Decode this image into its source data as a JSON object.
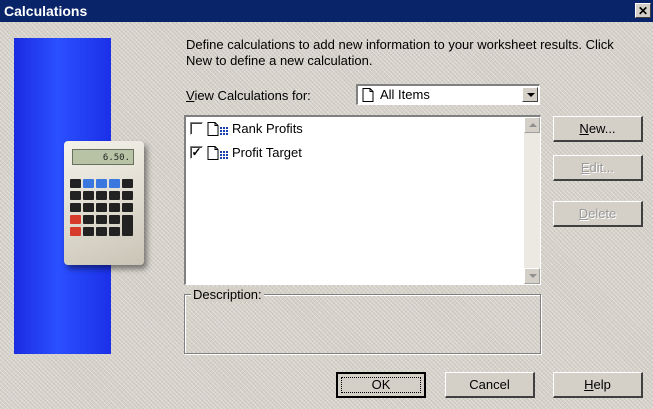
{
  "window": {
    "title": "Calculations",
    "close_glyph": "✕"
  },
  "instructions": "Define calculations to add new information to your worksheet results. Click New to define a new calculation.",
  "view": {
    "label_mnemonic": "V",
    "label_rest": "iew Calculations for:",
    "selected": "All Items",
    "icon": "document-icon"
  },
  "calculations": [
    {
      "label": "Rank Profits",
      "checked": false,
      "icon": "calculation-doc-icon"
    },
    {
      "label": "Profit Target",
      "checked": true,
      "icon": "calculation-doc-icon"
    }
  ],
  "description": {
    "label": "Description:",
    "text": ""
  },
  "side_buttons": {
    "new": {
      "mnemonic": "N",
      "rest": "ew..."
    },
    "edit": {
      "mnemonic": "E",
      "rest": "dit..."
    },
    "delete": {
      "mnemonic": "D",
      "rest": "elete"
    }
  },
  "bottom_buttons": {
    "ok": "OK",
    "cancel": "Cancel",
    "help": {
      "mnemonic": "H",
      "rest": "elp"
    }
  },
  "calculator_display": "6.50.",
  "colors": {
    "titlebar": "#0a246a",
    "panel": "#1f3cf0",
    "face": "#d4d0c8"
  }
}
